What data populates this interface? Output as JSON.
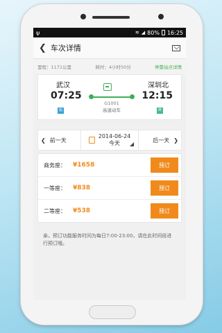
{
  "statusbar": {
    "usb_icon": "usb-icon",
    "battery_percent": "80%",
    "time": "16:25"
  },
  "appbar": {
    "title": "车次详情",
    "back_icon": "back-arrow-icon",
    "mail_icon": "mail-icon"
  },
  "info": {
    "distance": "里程：1171公里",
    "duration": "耗时：4小时50分",
    "stops_link": "停靠站点详情"
  },
  "train": {
    "from_station": "武汉",
    "to_station": "深圳北",
    "depart_time": "07:25",
    "arrive_time": "12:15",
    "number": "G1001",
    "type": "高速动车",
    "start_badge": "始",
    "end_badge": "终",
    "accent": "#3fae56"
  },
  "date_bar": {
    "prev_label": "前一天",
    "next_label": "后一天",
    "date": "2014-06-24",
    "day": "今天"
  },
  "seats": [
    {
      "name": "商务座：",
      "price": "¥1658",
      "button": "预订"
    },
    {
      "name": "一等座：",
      "price": "¥838",
      "button": "预订"
    },
    {
      "name": "二等座：",
      "price": "¥538",
      "button": "预订"
    }
  ],
  "notice": "亲，预订功能服务时间为每日7:00-23:00，请在此时间段进行预订哦。",
  "colors": {
    "orange": "#f08a1c",
    "green": "#3fae56"
  }
}
